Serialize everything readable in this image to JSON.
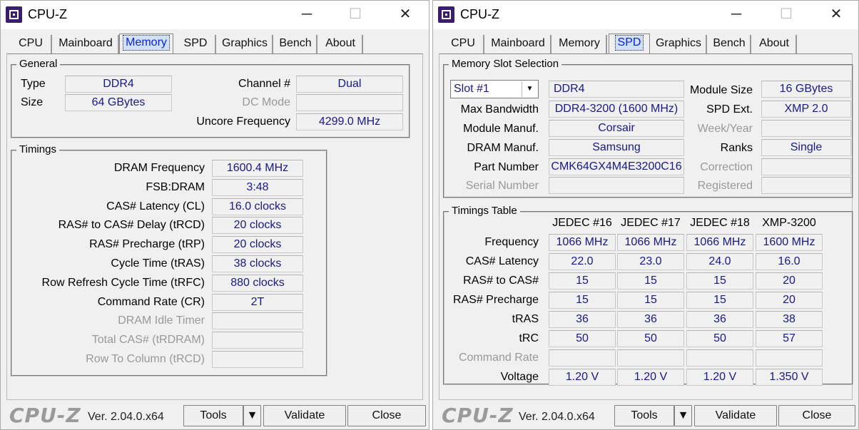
{
  "title": "CPU-Z",
  "logo_text": "CPU-Z",
  "version": "Ver. 2.04.0.x64",
  "buttons": {
    "tools": "Tools",
    "validate": "Validate",
    "close": "Close"
  },
  "window_controls": {
    "minimize": "─",
    "maximize": "☐",
    "close": "✕"
  },
  "tabs": [
    "CPU",
    "Mainboard",
    "Memory",
    "SPD",
    "Graphics",
    "Bench",
    "About"
  ],
  "memory": {
    "active_tab": "Memory",
    "general": {
      "title": "General",
      "type_label": "Type",
      "type": "DDR4",
      "size_label": "Size",
      "size": "64 GBytes",
      "channel_label": "Channel #",
      "channel": "Dual",
      "dc_mode_label": "DC Mode",
      "dc_mode": "",
      "uncore_label": "Uncore Frequency",
      "uncore": "4299.0 MHz"
    },
    "timings": {
      "title": "Timings",
      "rows": [
        {
          "label": "DRAM Frequency",
          "value": "1600.4 MHz"
        },
        {
          "label": "FSB:DRAM",
          "value": "3:48"
        },
        {
          "label": "CAS# Latency (CL)",
          "value": "16.0 clocks"
        },
        {
          "label": "RAS# to CAS# Delay (tRCD)",
          "value": "20 clocks"
        },
        {
          "label": "RAS# Precharge (tRP)",
          "value": "20 clocks"
        },
        {
          "label": "Cycle Time (tRAS)",
          "value": "38 clocks"
        },
        {
          "label": "Row Refresh Cycle Time (tRFC)",
          "value": "880 clocks"
        },
        {
          "label": "Command Rate (CR)",
          "value": "2T"
        },
        {
          "label": "DRAM Idle Timer",
          "value": ""
        },
        {
          "label": "Total CAS# (tRDRAM)",
          "value": ""
        },
        {
          "label": "Row To Column (tRCD)",
          "value": ""
        }
      ]
    }
  },
  "spd": {
    "active_tab": "SPD",
    "slot": {
      "title": "Memory Slot Selection",
      "selected_slot": "Slot #1",
      "type": "DDR4",
      "module_size_label": "Module Size",
      "module_size": "16 GBytes",
      "max_bandwidth_label": "Max Bandwidth",
      "max_bandwidth": "DDR4-3200 (1600 MHz)",
      "spd_ext_label": "SPD Ext.",
      "spd_ext": "XMP 2.0",
      "module_manuf_label": "Module Manuf.",
      "module_manuf": "Corsair",
      "week_year_label": "Week/Year",
      "week_year": "",
      "dram_manuf_label": "DRAM Manuf.",
      "dram_manuf": "Samsung",
      "ranks_label": "Ranks",
      "ranks": "Single",
      "part_number_label": "Part Number",
      "part_number": "CMK64GX4M4E3200C16",
      "correction_label": "Correction",
      "correction": "",
      "serial_label": "Serial Number",
      "serial": "",
      "registered_label": "Registered",
      "registered": ""
    },
    "timings_table": {
      "title": "Timings Table",
      "columns": [
        "JEDEC #16",
        "JEDEC #17",
        "JEDEC #18",
        "XMP-3200"
      ],
      "rows": [
        {
          "label": "Frequency",
          "values": [
            "1066 MHz",
            "1066 MHz",
            "1066 MHz",
            "1600 MHz"
          ]
        },
        {
          "label": "CAS# Latency",
          "values": [
            "22.0",
            "23.0",
            "24.0",
            "16.0"
          ]
        },
        {
          "label": "RAS# to CAS#",
          "values": [
            "15",
            "15",
            "15",
            "20"
          ]
        },
        {
          "label": "RAS# Precharge",
          "values": [
            "15",
            "15",
            "15",
            "20"
          ]
        },
        {
          "label": "tRAS",
          "values": [
            "36",
            "36",
            "36",
            "38"
          ]
        },
        {
          "label": "tRC",
          "values": [
            "50",
            "50",
            "50",
            "57"
          ]
        },
        {
          "label": "Command Rate",
          "values": [
            "",
            "",
            "",
            ""
          ]
        },
        {
          "label": "Voltage",
          "values": [
            "1.20 V",
            "1.20 V",
            "1.20 V",
            "1.350 V"
          ]
        }
      ]
    }
  }
}
